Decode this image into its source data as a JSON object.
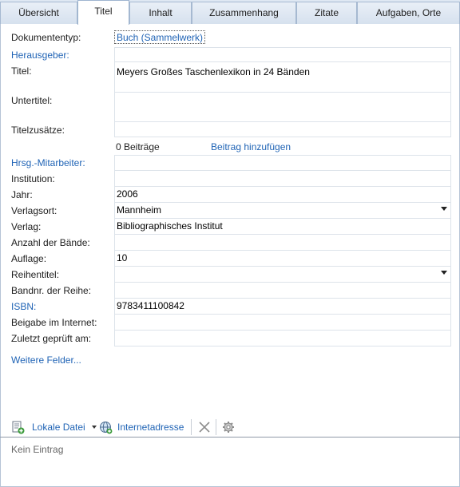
{
  "tabs": [
    {
      "label": "Übersicht"
    },
    {
      "label": "Titel"
    },
    {
      "label": "Inhalt"
    },
    {
      "label": "Zusammenhang"
    },
    {
      "label": "Zitate"
    },
    {
      "label": "Aufgaben, Orte"
    }
  ],
  "active_tab": "Titel",
  "form": {
    "doctype_label": "Dokumententyp:",
    "doctype_value": "Buch (Sammelwerk)",
    "editors_label": "Herausgeber:",
    "title_label": "Titel:",
    "title_value": "Meyers Großes Taschenlexikon in 24 Bänden",
    "subtitle_label": "Untertitel:",
    "title_supplement_label": "Titelzusätze:",
    "contributions_count": "0 Beiträge",
    "add_contribution": "Beitrag hinzufügen",
    "coeditors_label": "Hrsg.-Mitarbeiter:",
    "institution_label": "Institution:",
    "year_label": "Jahr:",
    "year_value": "2006",
    "place_label": "Verlagsort:",
    "place_value": "Mannheim",
    "publisher_label": "Verlag:",
    "publisher_value": "Bibliographisches Institut",
    "volumes_label": "Anzahl der Bände:",
    "edition_label": "Auflage:",
    "edition_value": "10",
    "series_label": "Reihentitel:",
    "series_number_label": "Bandnr. der Reihe:",
    "isbn_label": "ISBN:",
    "isbn_value": "9783411100842",
    "online_supplement_label": "Beigabe im Internet:",
    "last_checked_label": "Zuletzt geprüft am:",
    "more_fields": "Weitere Felder..."
  },
  "toolbar": {
    "local_file_label": "Lokale Datei",
    "web_address_label": "Internetadresse"
  },
  "attachments": {
    "empty_text": "Kein Eintrag"
  },
  "colors": {
    "link": "#1f63b5",
    "tab_strip": "#dfe8f3",
    "field_border": "#dde3ea"
  }
}
